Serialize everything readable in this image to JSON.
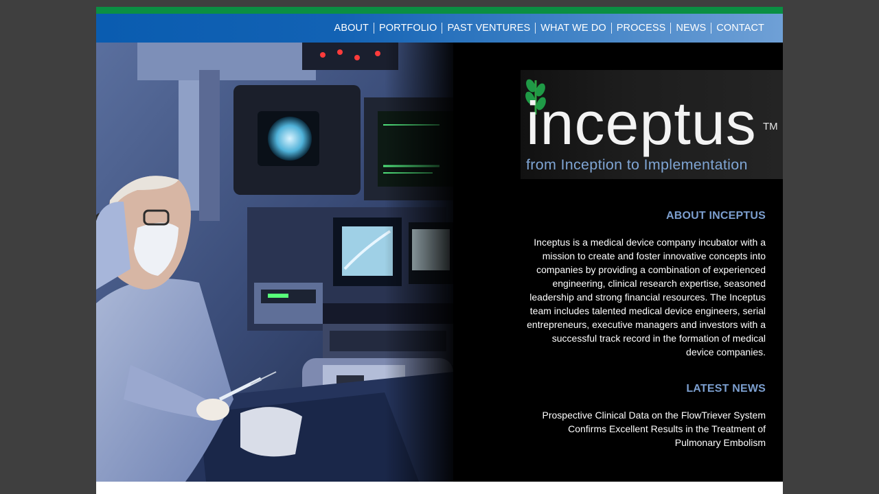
{
  "nav": {
    "items": [
      {
        "label": "ABOUT"
      },
      {
        "label": "PORTFOLIO"
      },
      {
        "label": "PAST VENTURES"
      },
      {
        "label": "WHAT WE DO"
      },
      {
        "label": "PROCESS"
      },
      {
        "label": "NEWS"
      },
      {
        "label": "CONTACT"
      }
    ]
  },
  "logo": {
    "wordmark": "inceptus",
    "trademark": "TM",
    "tagline": "from Inception to Implementation",
    "icon": "leaf-sprout-icon"
  },
  "about": {
    "title": "ABOUT INCEPTUS",
    "body": "Inceptus is a medical device company incubator with a mission to create and foster innovative concepts into companies by providing a combination of experienced engineering, clinical research expertise, seasoned leadership and strong financial resources. The Inceptus team includes talented medical device engineers, serial entrepreneurs, executive managers and investors with a successful track record in the formation of medical device companies."
  },
  "news": {
    "title": "LATEST NEWS",
    "headline": "Prospective Clinical Data on the FlowTriever System Confirms Excellent Results in the Treatment of Pulmonary Embolism"
  },
  "colors": {
    "green_bar": "#0b8f43",
    "nav_blue": "#0a5cb0",
    "accent_blue": "#7c9fcf",
    "tagline_blue": "#7fa5d4"
  }
}
